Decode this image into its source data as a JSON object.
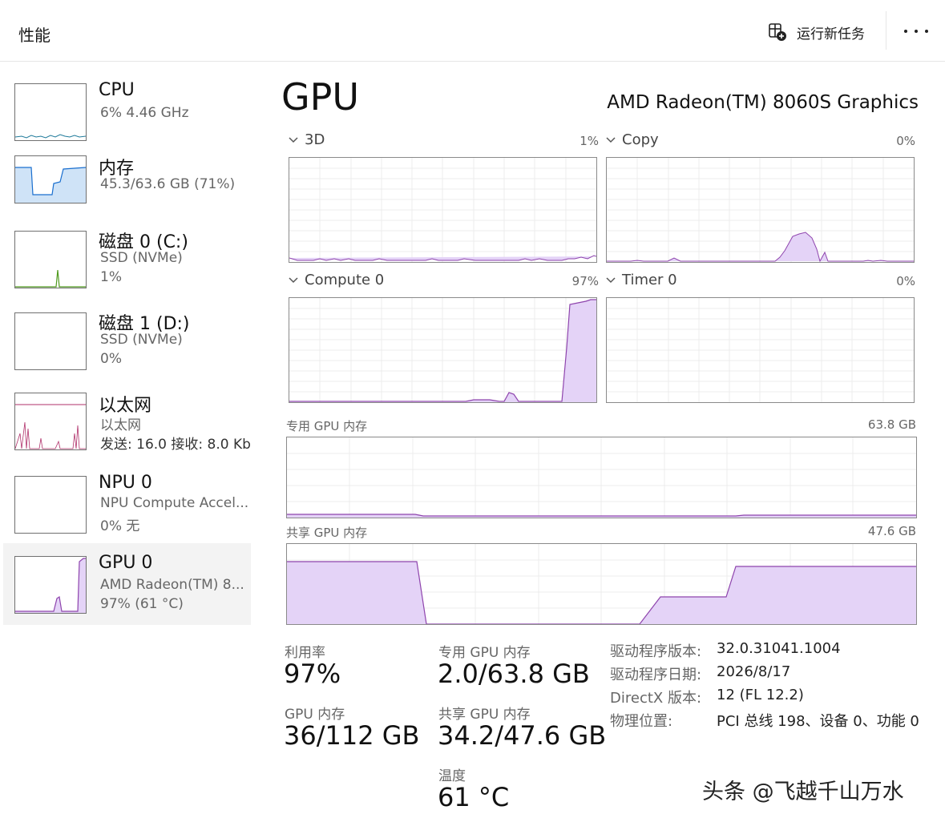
{
  "header": {
    "title": "性能",
    "run_task_label": "运行新任务",
    "more_icon": "more-horizontal-icon"
  },
  "sidebar": {
    "items": [
      {
        "title": "CPU",
        "line1": "6%  4.46 GHz",
        "line2": "",
        "active": false
      },
      {
        "title": "内存",
        "line1": "45.3/63.6 GB (71%)",
        "line2": "",
        "active": false
      },
      {
        "title": "磁盘 0 (C:)",
        "line1": "SSD (NVMe)",
        "line2": "1%",
        "active": false
      },
      {
        "title": "磁盘 1 (D:)",
        "line1": "SSD (NVMe)",
        "line2": "0%",
        "active": false
      },
      {
        "title": "以太网",
        "line1": "以太网",
        "line2": "发送: 16.0  接收: 8.0 Kb",
        "active": false
      },
      {
        "title": "NPU 0",
        "line1": "NPU Compute Accel...",
        "line2": "0%  无",
        "active": false
      },
      {
        "title": "GPU 0",
        "line1": "AMD Radeon(TM) 8...",
        "line2": "97% (61 °C)",
        "active": true
      }
    ]
  },
  "main": {
    "heading": "GPU",
    "device_name": "AMD Radeon(TM) 8060S Graphics",
    "engines": [
      {
        "name": "3D",
        "value": "1%"
      },
      {
        "name": "Copy",
        "value": "0%"
      },
      {
        "name": "Compute 0",
        "value": "97%"
      },
      {
        "name": "Timer 0",
        "value": "0%"
      }
    ],
    "dedicated_memory": {
      "label": "专用 GPU 内存",
      "max": "63.8 GB"
    },
    "shared_memory": {
      "label": "共享 GPU 内存",
      "max": "47.6 GB"
    }
  },
  "stats": {
    "utilization": {
      "label": "利用率",
      "value": "97%"
    },
    "dedicated": {
      "label": "专用 GPU 内存",
      "value": "2.0/63.8 GB"
    },
    "gpu_memory": {
      "label": "GPU 内存",
      "value": "36/112 GB"
    },
    "shared": {
      "label": "共享 GPU 内存",
      "value": "34.2/47.6 GB"
    },
    "temperature": {
      "label": "温度",
      "value": "61 °C"
    }
  },
  "info": [
    {
      "key": "驱动程序版本:",
      "value": "32.0.31041.1004"
    },
    {
      "key": "驱动程序日期:",
      "value": "2026/8/17"
    },
    {
      "key": "DirectX 版本:",
      "value": "12 (FL 12.2)"
    },
    {
      "key": "物理位置:",
      "value": "PCI 总线 198、设备 0、功能 0"
    }
  ],
  "watermark": "头条 @飞越千山万水",
  "colors": {
    "gpu_line": "#8e44ad",
    "gpu_fill": "#e4d3f7",
    "memory_line": "#1a6fcf",
    "memory_fill": "#cfe3f7",
    "disk_line": "#4f9a1e",
    "ethernet_line": "#b0306a",
    "cpu_line": "#1f7a9a"
  }
}
